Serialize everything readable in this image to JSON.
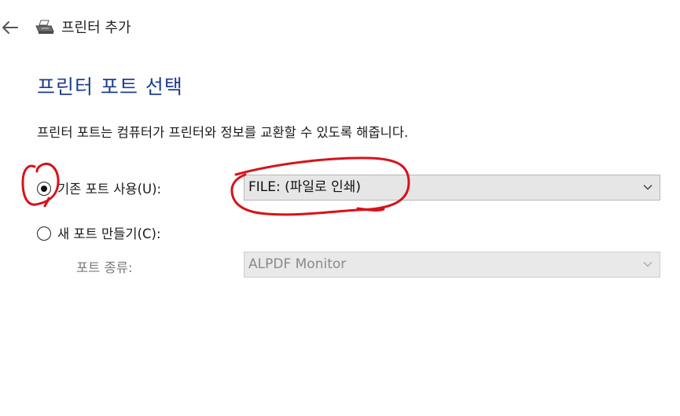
{
  "window": {
    "title": "프린터 추가",
    "back_icon": "back-arrow-icon",
    "printer_icon": "printer-icon"
  },
  "page": {
    "heading": "프린터 포트 선택",
    "description": "프린터 포트는 컴퓨터가 프린터와 정보를 교환할 수 있도록 해줍니다."
  },
  "options": {
    "existing_port": {
      "label": "기존 포트 사용(U):",
      "selected": true,
      "value": "FILE: (파일로 인쇄)"
    },
    "new_port": {
      "label": "새 포트 만들기(C):",
      "selected": false,
      "type_label": "포트 종류:",
      "type_value": "ALPDF Monitor"
    }
  },
  "colors": {
    "heading": "#1f3d8f",
    "annotation": "#d8121b"
  }
}
